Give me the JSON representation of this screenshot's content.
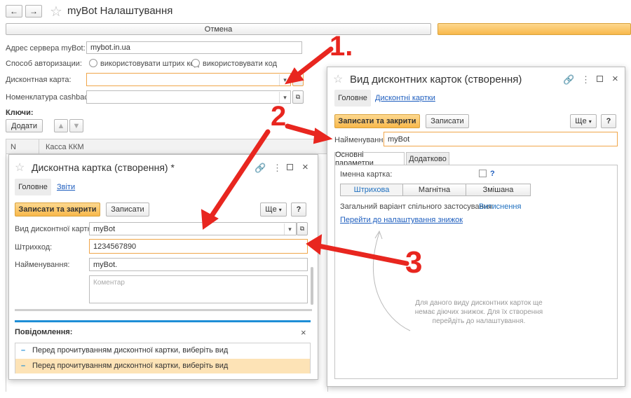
{
  "main": {
    "title": "myBot Налаштування",
    "cancel_label": "Отмена",
    "server_label": "Адрес сервера myBot:",
    "server_value": "mybot.in.ua",
    "auth_label": "Способ авторизации:",
    "auth_option_1": "використовувати штрих код",
    "auth_option_2": "використовувати код",
    "discount_label": "Дисконтная карта:",
    "nomenclature_label": "Номенклатура cashback:",
    "keys_label": "Ключи:",
    "add_label": "Додати",
    "table_headers": [
      "N",
      "Касса ККМ"
    ]
  },
  "card_win": {
    "title": "Дисконтна картка (створення) *",
    "tabs": [
      "Головне",
      "Звіти"
    ],
    "save_close_label": "Записати та закрити",
    "save_label": "Записати",
    "more_label": "Ще",
    "help_label": "?",
    "kind_label": "Вид дисконтної картки:",
    "kind_value": "myBot",
    "barcode_label": "Штрихкод:",
    "barcode_value": "1234567890",
    "name_label": "Найменування:",
    "name_value": "myBot.",
    "comment_placeholder": "Коментар",
    "messages_title": "Повідомлення:",
    "messages": [
      "Перед прочитуванням дисконтної картки, виберіть вид",
      "Перед прочитуванням дисконтної картки, виберіть вид"
    ]
  },
  "kind_win": {
    "title": "Вид дисконтних карток (створення)",
    "tabs": [
      "Головне",
      "Дисконтні картки"
    ],
    "save_close_label": "Записати та закрити",
    "save_label": "Записати",
    "more_label": "Ще",
    "help_label": "?",
    "name_label": "Найменування:",
    "name_value": "myBot",
    "subtabs": [
      "Основні параметри",
      "Додатково"
    ],
    "named_card_label": "Іменна картка:",
    "named_card_help": "?",
    "segments": [
      "Штрихова",
      "Магнітна",
      "Змішана"
    ],
    "variant_label": "Загальний варіант спільного застосування:",
    "variant_value": "Витиснення",
    "discount_link": "Перейти до налаштування знижок",
    "hint_text": "Для даного виду дисконтних карток ще немає діючих знижок. Для їх створення перейдіть до налаштування."
  },
  "annotations": [
    "1.",
    "2",
    "3"
  ],
  "colors": {
    "accent_yellow": "#f8b84b",
    "link_blue": "#1f5fbf",
    "arrow_red": "#e8261f",
    "message_highlight": "#fde3b6"
  }
}
